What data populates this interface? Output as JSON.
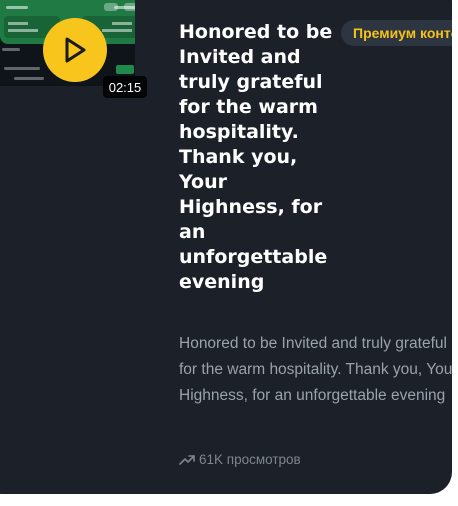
{
  "video": {
    "duration": "02:15",
    "play_icon": "play-icon"
  },
  "post": {
    "title": "Honored to be Invited and truly grateful for the warm hospitality. Thank you, Your Highness, for an unforgettable evening",
    "description": "Honored to be Invited and truly grateful for the warm hospitality. Thank you, Your Highness, for an unforgettable evening",
    "badge": "Премиум контент",
    "views": "61K просмотров",
    "views_icon": "trending-up-icon"
  },
  "colors": {
    "card_bg": "#1c2129",
    "accent_yellow": "#f7c51b",
    "badge_bg": "#2d3540",
    "muted_text": "#9aa2ad"
  }
}
